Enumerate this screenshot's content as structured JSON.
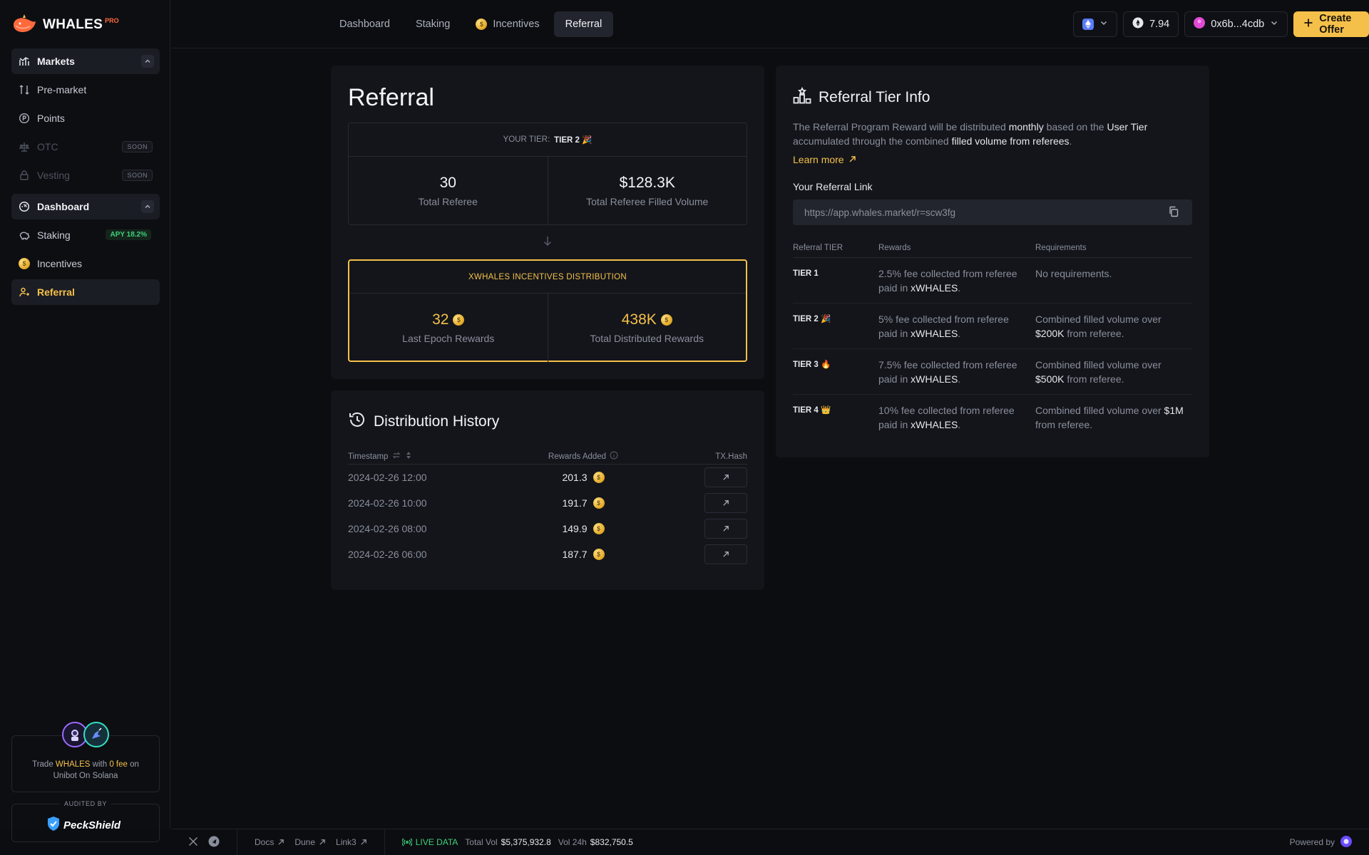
{
  "brand": {
    "name": "WHALES",
    "tag": "PRO"
  },
  "sidebar": {
    "items": [
      {
        "label": "Markets"
      },
      {
        "label": "Pre-market"
      },
      {
        "label": "Points"
      },
      {
        "label": "OTC",
        "badge": "SOON"
      },
      {
        "label": "Vesting",
        "badge": "SOON"
      },
      {
        "label": "Dashboard"
      },
      {
        "label": "Staking",
        "badge": "APY 18.2%"
      },
      {
        "label": "Incentives"
      },
      {
        "label": "Referral"
      }
    ],
    "promo": {
      "t1": "Trade ",
      "t2": "WHALES",
      "t3": " with ",
      "t4": "0 fee",
      "t5": " on",
      "t6": "Unibot On Solana"
    },
    "audit": {
      "label": "AUDITED BY",
      "name": "PeckShield"
    }
  },
  "topbar": {
    "tabs": [
      "Dashboard",
      "Staking",
      "Incentives",
      "Referral"
    ],
    "balance": "7.94",
    "wallet": "0x6b...4cdb",
    "create_offer": "Create Offer"
  },
  "referral": {
    "title": "Referral",
    "tier_label": "YOUR TIER:",
    "tier_value": "TIER 2 🎉",
    "stats": [
      {
        "value": "30",
        "label": "Total Referee"
      },
      {
        "value": "$128.3K",
        "label": "Total Referee Filled Volume"
      }
    ],
    "incentives_title": "XWHALES INCENTIVES DISTRIBUTION",
    "incentives": [
      {
        "value": "32",
        "label": "Last Epoch Rewards"
      },
      {
        "value": "438K",
        "label": "Total Distributed Rewards"
      }
    ]
  },
  "history": {
    "title": "Distribution History",
    "columns": [
      "Timestamp",
      "Rewards Added",
      "TX.Hash"
    ],
    "rows": [
      {
        "timestamp": "2024-02-26 12:00",
        "reward": "201.3"
      },
      {
        "timestamp": "2024-02-26 10:00",
        "reward": "191.7"
      },
      {
        "timestamp": "2024-02-26 08:00",
        "reward": "149.9"
      },
      {
        "timestamp": "2024-02-26 06:00",
        "reward": "187.7"
      }
    ]
  },
  "tier_info": {
    "title": "Referral Tier Info",
    "desc": {
      "a": "The Referral Program Reward will be distributed ",
      "b": "monthly",
      "c": " based on the ",
      "d": "User Tier",
      "e": " accumulated through the combined ",
      "f": "filled volume from referees",
      "g": "."
    },
    "learn_more": "Learn more",
    "link_label": "Your Referral Link",
    "link_value": "https://app.whales.market/r=scw3fg",
    "columns": [
      "Referral TIER",
      "Rewards",
      "Requirements"
    ],
    "tiers": [
      {
        "name": "TIER 1",
        "reward": "2.5% fee collected from referee paid in ",
        "token": "xWHALES",
        "req_pre": "No requirements.",
        "req_amt": "",
        "req_post": ""
      },
      {
        "name": "TIER 2 🎉",
        "reward": "5% fee collected from referee paid in ",
        "token": "xWHALES",
        "req_pre": "Combined filled volume over ",
        "req_amt": "$200K",
        "req_post": " from referee."
      },
      {
        "name": "TIER 3 🔥",
        "reward": "7.5% fee collected from referee paid in ",
        "token": "xWHALES",
        "req_pre": "Combined filled volume over ",
        "req_amt": "$500K",
        "req_post": " from referee."
      },
      {
        "name": "TIER 4 👑",
        "reward": "10% fee collected from referee paid in ",
        "token": "xWHALES",
        "req_pre": "Combined filled volume over ",
        "req_amt": "$1M",
        "req_post": " from referee."
      }
    ]
  },
  "footer": {
    "links": [
      "Docs",
      "Dune",
      "Link3"
    ],
    "live": "LIVE DATA",
    "total_vol_label": "Total Vol",
    "total_vol": "$5,375,932.8",
    "vol24_label": "Vol 24h",
    "vol24": "$832,750.5",
    "powered": "Powered by"
  },
  "colors": {
    "accent": "#f5c04a",
    "bg": "#0c0d11",
    "panel": "#13151a",
    "success": "#3fd17a"
  }
}
